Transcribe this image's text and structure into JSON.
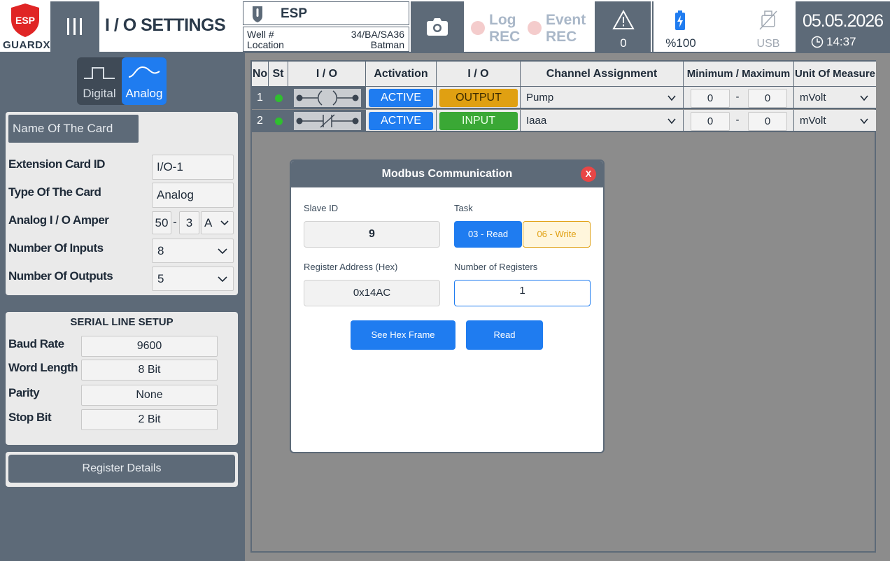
{
  "header": {
    "brand_logo_text": "ESP",
    "brand_name": "GUARDX",
    "page_title": "I / O SETTINGS",
    "device_label": "ESP",
    "well_label": "Well #",
    "well_value": "34/BA/SA36",
    "location_label": "Location",
    "location_value": "Batman",
    "log_rec": [
      "Log",
      "REC"
    ],
    "event_rec": [
      "Event",
      "REC"
    ],
    "alarm_count": "0",
    "battery_level": "%100",
    "usb_label": "USB",
    "date": "05.05.2026",
    "time": "14:37"
  },
  "left_panel": {
    "mode_toggle": {
      "digital": "Digital",
      "analog": "Analog",
      "selected": "Analog"
    },
    "card_name_placeholder": "Name Of The Card",
    "fields": {
      "extension_card_id_label": "Extension Card ID",
      "extension_card_id_value": "I/O-1",
      "card_type_label": "Type Of The Card",
      "card_type_value": "Analog",
      "amper_label": "Analog I / O Amper",
      "amper_a": "50",
      "amper_sep": "-",
      "amper_b": "3",
      "amper_unit": "A",
      "inputs_label": "Number Of Inputs",
      "inputs_value": "8",
      "outputs_label": "Number Of Outputs",
      "outputs_value": "5"
    },
    "serial": {
      "title": "SERIAL LINE SETUP",
      "baud_label": "Baud Rate",
      "baud_value": "9600",
      "word_label": "Word Length",
      "word_value": "8 Bit",
      "parity_label": "Parity",
      "parity_value": "None",
      "stop_label": "Stop Bit",
      "stop_value": "2 Bit"
    },
    "register_details_button": "Register Details"
  },
  "table": {
    "headers": [
      "No",
      "St",
      "I / O",
      "Activation",
      "I / O",
      "Channel Assignment",
      "Minimum / Maximum",
      "Unit Of Measure"
    ],
    "rows": [
      {
        "no": "1",
        "activation": "ACTIVE",
        "io": "OUTPUT",
        "channel": "Pump",
        "min": "0",
        "sep": "-",
        "max": "0",
        "unit": "mVolt"
      },
      {
        "no": "2",
        "activation": "ACTIVE",
        "io": "INPUT",
        "channel": "Iaaa",
        "min": "0",
        "sep": "-",
        "max": "0",
        "unit": "mVolt"
      }
    ]
  },
  "modal": {
    "title": "Modbus Communication",
    "close_label": "X",
    "slave_id_label": "Slave ID",
    "slave_id_value": "9",
    "task_label": "Task",
    "task_read": "03 - Read",
    "task_write": "06 - Write",
    "task_selected": "03 - Read",
    "register_address_label": "Register Address (Hex)",
    "register_address_value": "0x14AC",
    "num_registers_label": "Number of Registers",
    "num_registers_value": "1",
    "see_hex_button": "See Hex Frame",
    "read_button": "Read"
  },
  "colors": {
    "panel": "#5d6a78",
    "accent_blue": "#1f7cf0",
    "output_amber": "#e0a012",
    "input_green": "#3aa835",
    "status_dot": "#2fbf2f",
    "close_red": "#e84646"
  }
}
